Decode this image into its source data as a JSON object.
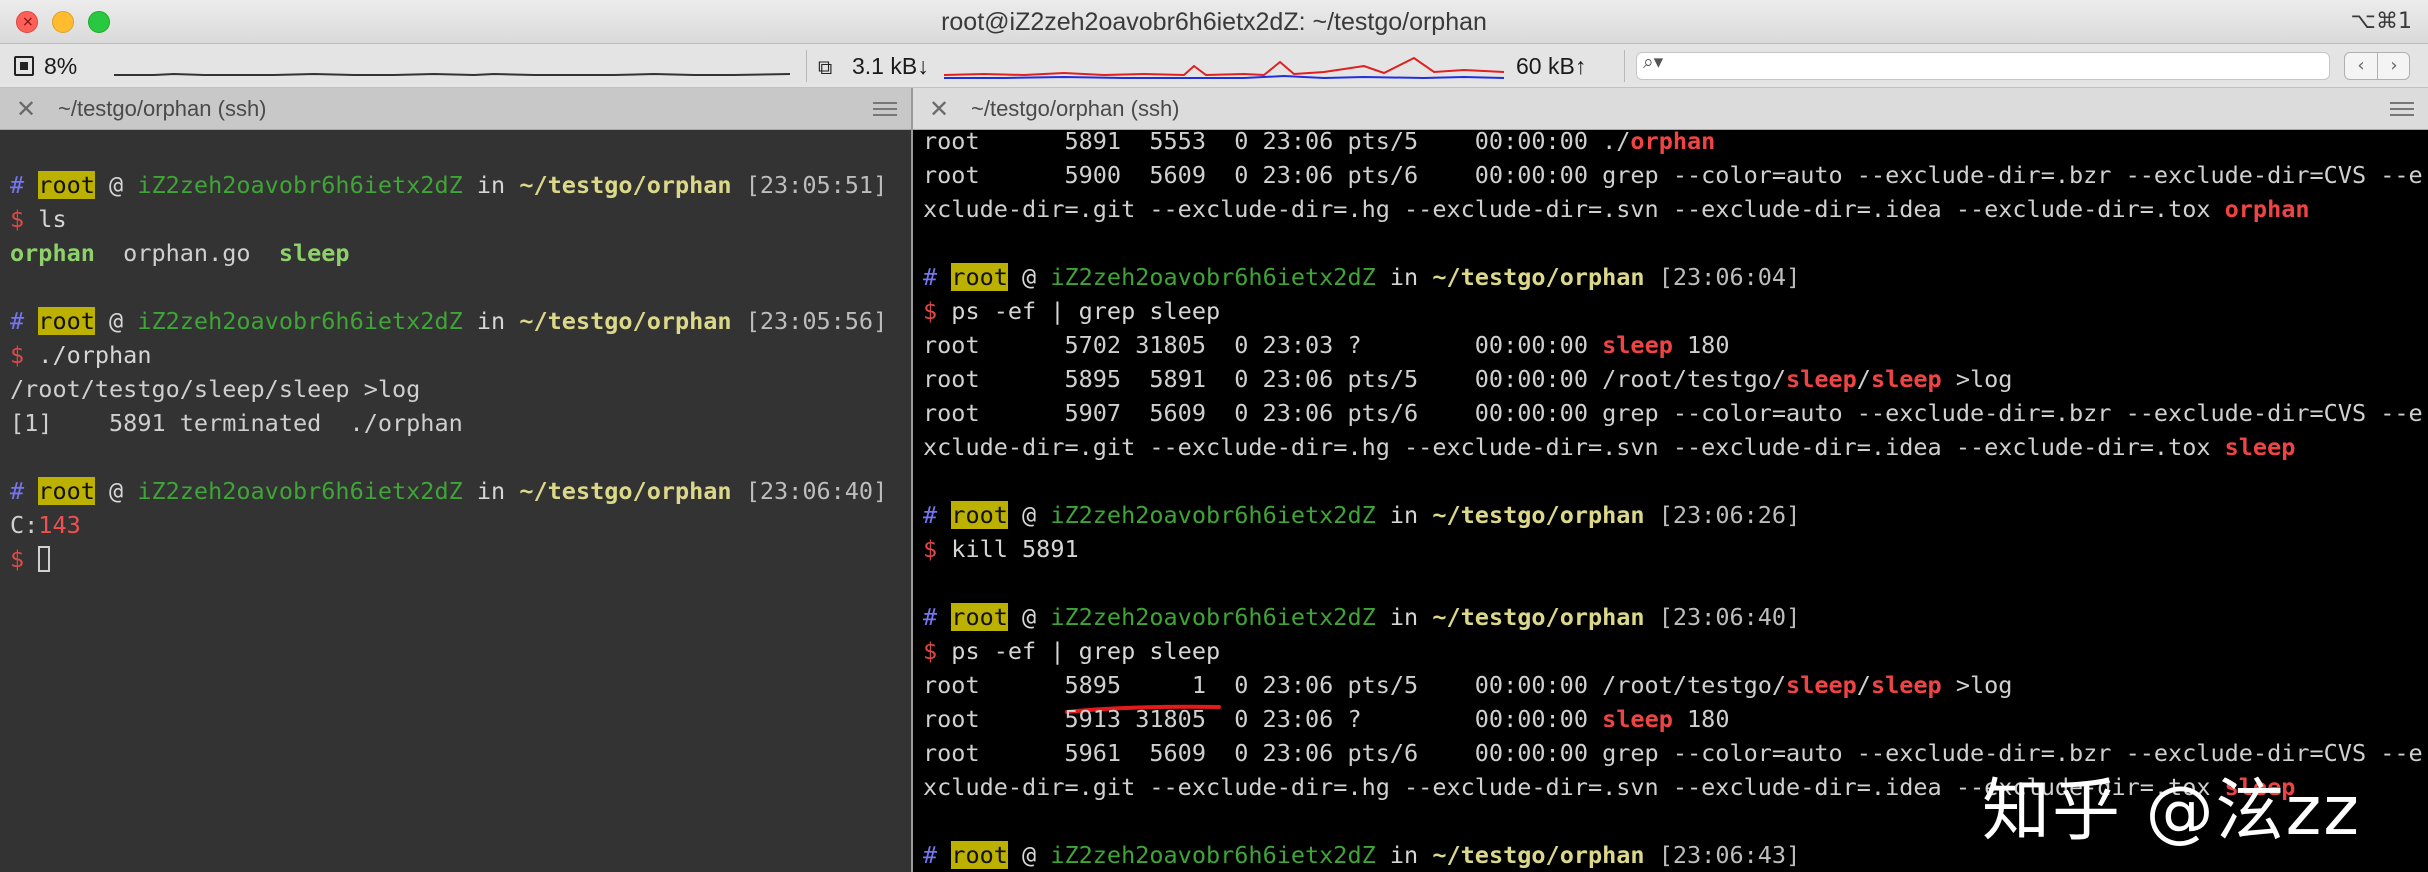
{
  "window": {
    "title": "root@iZ2zeh2oavobr6h6ietx2dZ: ~/testgo/orphan",
    "shortcut": "⌥⌘1",
    "close_glyph": "×"
  },
  "status": {
    "cpu": "8%",
    "net_down": "3.1 kB↓",
    "net_up": "60 kB↑",
    "search_placeholder": "",
    "search_icon": "search-icon",
    "prev_glyph": "‹",
    "next_glyph": "›"
  },
  "colors": {
    "cpu_graph": "#333333",
    "net_down_graph": "#e02020",
    "net_up_graph": "#2030e0",
    "prompt_user_bg": "#bcb100",
    "host": "#3ea536",
    "path": "#dcd88a",
    "highlight": "#f04444",
    "left_bg": "#333333",
    "right_bg": "#000000"
  },
  "panes": {
    "left": {
      "title": "~/testgo/orphan (ssh)",
      "lines": [
        [],
        [
          {
            "t": "# ",
            "c": "c-hash"
          },
          {
            "t": "root",
            "c": "c-root"
          },
          {
            "t": " @ ",
            "c": "c-white"
          },
          {
            "t": "iZ2zeh2oavobr6h6ietx2dZ",
            "c": "c-host"
          },
          {
            "t": " in ",
            "c": "c-white"
          },
          {
            "t": "~/testgo/orphan",
            "c": "c-path"
          },
          {
            "t": " [23:05:51]",
            "c": "c-time"
          }
        ],
        [
          {
            "t": "$ ",
            "c": "c-dollar"
          },
          {
            "t": "ls",
            "c": "c-white"
          }
        ],
        [
          {
            "t": "orphan",
            "c": "c-green"
          },
          {
            "t": "  orphan.go  ",
            "c": ""
          },
          {
            "t": "sleep",
            "c": "c-green"
          }
        ],
        [],
        [
          {
            "t": "# ",
            "c": "c-hash"
          },
          {
            "t": "root",
            "c": "c-root"
          },
          {
            "t": " @ ",
            "c": "c-white"
          },
          {
            "t": "iZ2zeh2oavobr6h6ietx2dZ",
            "c": "c-host"
          },
          {
            "t": " in ",
            "c": "c-white"
          },
          {
            "t": "~/testgo/orphan",
            "c": "c-path"
          },
          {
            "t": " [23:05:56]",
            "c": "c-time"
          }
        ],
        [
          {
            "t": "$ ",
            "c": "c-dollar"
          },
          {
            "t": "./orphan",
            "c": "c-white"
          }
        ],
        [
          {
            "t": "/root/testgo/sleep/sleep >log",
            "c": ""
          }
        ],
        [
          {
            "t": "[1]    5891 terminated  ./orphan",
            "c": ""
          }
        ],
        [],
        [
          {
            "t": "# ",
            "c": "c-hash"
          },
          {
            "t": "root",
            "c": "c-root"
          },
          {
            "t": " @ ",
            "c": "c-white"
          },
          {
            "t": "iZ2zeh2oavobr6h6ietx2dZ",
            "c": "c-host"
          },
          {
            "t": " in ",
            "c": "c-white"
          },
          {
            "t": "~/testgo/orphan",
            "c": "c-path"
          },
          {
            "t": " [23:06:40]",
            "c": "c-time"
          }
        ],
        [
          {
            "t": "C:",
            "c": ""
          },
          {
            "t": "143",
            "c": "c-err"
          }
        ],
        [
          {
            "t": "$ ",
            "c": "c-dollar"
          },
          {
            "cursor": true
          }
        ]
      ]
    },
    "right": {
      "title": "~/testgo/orphan (ssh)",
      "lines": [
        [
          {
            "t": "root      5891  5553  0 23:06 pts/5    00:00:00 ./",
            "c": ""
          },
          {
            "t": "orphan",
            "c": "c-red"
          }
        ],
        [
          {
            "t": "root      5900  5609  0 23:06 pts/6    00:00:00 grep --color=auto --exclude-dir=.bzr --exclude-dir=CVS --e",
            "c": ""
          }
        ],
        [
          {
            "t": "xclude-dir=.git --exclude-dir=.hg --exclude-dir=.svn --exclude-dir=.idea --exclude-dir=.tox ",
            "c": ""
          },
          {
            "t": "orphan",
            "c": "c-red"
          }
        ],
        [],
        [
          {
            "t": "# ",
            "c": "c-hash"
          },
          {
            "t": "root",
            "c": "c-root"
          },
          {
            "t": " @ ",
            "c": "c-white"
          },
          {
            "t": "iZ2zeh2oavobr6h6ietx2dZ",
            "c": "c-host"
          },
          {
            "t": " in ",
            "c": "c-white"
          },
          {
            "t": "~/testgo/orphan",
            "c": "c-path"
          },
          {
            "t": " [23:06:04]",
            "c": "c-time"
          }
        ],
        [
          {
            "t": "$ ",
            "c": "c-dollar"
          },
          {
            "t": "ps -ef | grep sleep",
            "c": "c-white"
          }
        ],
        [
          {
            "t": "root      5702 31805  0 23:03 ?        00:00:00 ",
            "c": ""
          },
          {
            "t": "sleep",
            "c": "c-red"
          },
          {
            "t": " 180",
            "c": ""
          }
        ],
        [
          {
            "t": "root      5895  5891  0 23:06 pts/5    00:00:00 /root/testgo/",
            "c": ""
          },
          {
            "t": "sleep",
            "c": "c-red"
          },
          {
            "t": "/",
            "c": ""
          },
          {
            "t": "sleep",
            "c": "c-red"
          },
          {
            "t": " >log",
            "c": ""
          }
        ],
        [
          {
            "t": "root      5907  5609  0 23:06 pts/6    00:00:00 grep --color=auto --exclude-dir=.bzr --exclude-dir=CVS --e",
            "c": ""
          }
        ],
        [
          {
            "t": "xclude-dir=.git --exclude-dir=.hg --exclude-dir=.svn --exclude-dir=.idea --exclude-dir=.tox ",
            "c": ""
          },
          {
            "t": "sleep",
            "c": "c-red"
          }
        ],
        [],
        [
          {
            "t": "# ",
            "c": "c-hash"
          },
          {
            "t": "root",
            "c": "c-root"
          },
          {
            "t": " @ ",
            "c": "c-white"
          },
          {
            "t": "iZ2zeh2oavobr6h6ietx2dZ",
            "c": "c-host"
          },
          {
            "t": " in ",
            "c": "c-white"
          },
          {
            "t": "~/testgo/orphan",
            "c": "c-path"
          },
          {
            "t": " [23:06:26]",
            "c": "c-time"
          }
        ],
        [
          {
            "t": "$ ",
            "c": "c-dollar"
          },
          {
            "t": "kill 5891",
            "c": "c-white"
          }
        ],
        [],
        [
          {
            "t": "# ",
            "c": "c-hash"
          },
          {
            "t": "root",
            "c": "c-root"
          },
          {
            "t": " @ ",
            "c": "c-white"
          },
          {
            "t": "iZ2zeh2oavobr6h6ietx2dZ",
            "c": "c-host"
          },
          {
            "t": " in ",
            "c": "c-white"
          },
          {
            "t": "~/testgo/orphan",
            "c": "c-path"
          },
          {
            "t": " [23:06:40]",
            "c": "c-time"
          }
        ],
        [
          {
            "t": "$ ",
            "c": "c-dollar"
          },
          {
            "t": "ps -ef | grep sleep",
            "c": "c-white"
          }
        ],
        [
          {
            "t": "root      5895     1  0 23:06 pts/5    00:00:00 /root/testgo/",
            "c": ""
          },
          {
            "t": "sleep",
            "c": "c-red"
          },
          {
            "t": "/",
            "c": ""
          },
          {
            "t": "sleep",
            "c": "c-red"
          },
          {
            "t": " >log",
            "c": ""
          }
        ],
        [
          {
            "t": "root      5913 31805  0 23:06 ?        00:00:00 ",
            "c": ""
          },
          {
            "t": "sleep",
            "c": "c-red"
          },
          {
            "t": " 180",
            "c": ""
          }
        ],
        [
          {
            "t": "root      5961  5609  0 23:06 pts/6    00:00:00 grep --color=auto --exclude-dir=.bzr --exclude-dir=CVS --e",
            "c": ""
          }
        ],
        [
          {
            "t": "xclude-dir=.git --exclude-dir=.hg --exclude-dir=.svn --exclude-dir=.idea --exclude-dir=.tox ",
            "c": ""
          },
          {
            "t": "sleep",
            "c": "c-red"
          }
        ],
        [],
        [
          {
            "t": "# ",
            "c": "c-hash"
          },
          {
            "t": "root",
            "c": "c-root"
          },
          {
            "t": " @ ",
            "c": "c-white"
          },
          {
            "t": "iZ2zeh2oavobr6h6ietx2dZ",
            "c": "c-host"
          },
          {
            "t": " in ",
            "c": "c-white"
          },
          {
            "t": "~/testgo/orphan",
            "c": "c-path"
          },
          {
            "t": " [23:06:43]",
            "c": "c-time"
          }
        ]
      ]
    }
  },
  "watermark": "知乎 @泫zz"
}
